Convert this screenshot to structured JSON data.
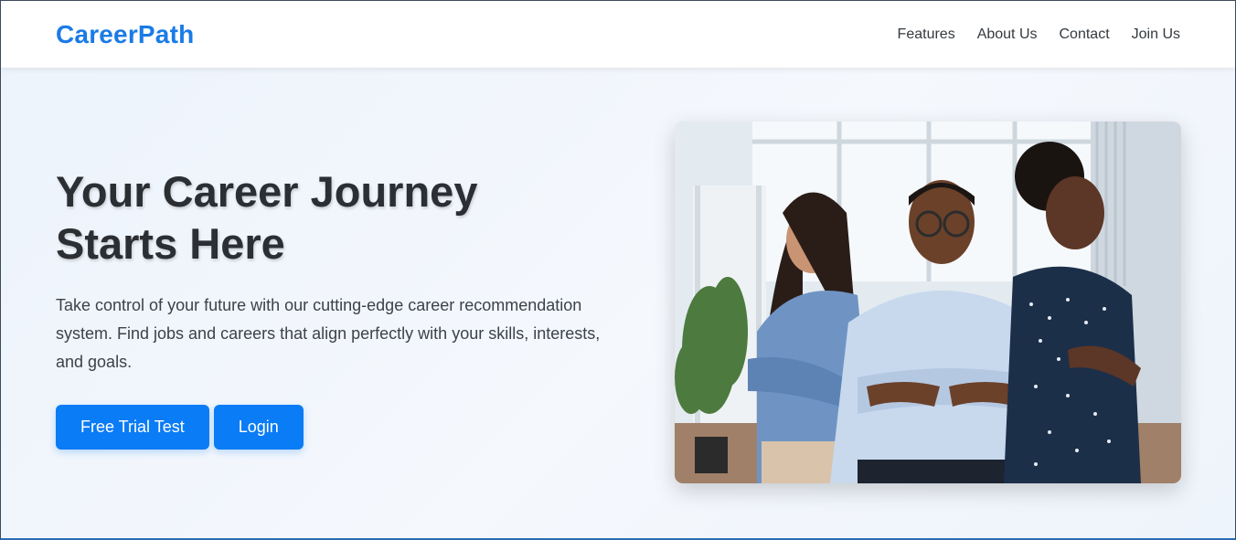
{
  "brand": {
    "name": "CareerPath",
    "color": "#1a7be6"
  },
  "nav": {
    "links": [
      {
        "label": "Features"
      },
      {
        "label": "About Us"
      },
      {
        "label": "Contact"
      },
      {
        "label": "Join Us"
      }
    ]
  },
  "hero": {
    "title_line1": "Your Career Journey",
    "title_line2": "Starts Here",
    "description": "Take control of your future with our cutting-edge career recommendation system. Find jobs and careers that align perfectly with your skills, interests, and goals.",
    "buttons": {
      "primary": "Free Trial Test",
      "secondary": "Login"
    },
    "accent_color": "#0a7cf5",
    "image": {
      "content": "three smiling professionals with arms crossed in a bright office"
    }
  }
}
